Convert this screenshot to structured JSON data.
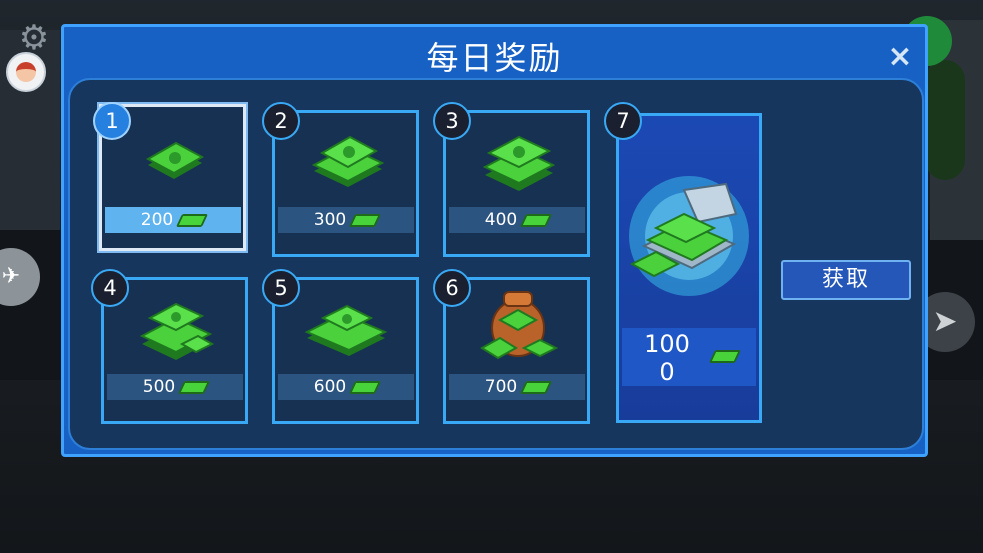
{
  "title": "每日奖励",
  "close_icon": "×",
  "claim_label": "获取",
  "days": [
    {
      "day": "1",
      "value": "200",
      "selected": true
    },
    {
      "day": "2",
      "value": "300"
    },
    {
      "day": "3",
      "value": "400"
    },
    {
      "day": "4",
      "value": "500"
    },
    {
      "day": "5",
      "value": "600"
    },
    {
      "day": "6",
      "value": "700"
    }
  ],
  "big_day": {
    "day": "7",
    "value_line1": "100",
    "value_line2": "0"
  },
  "colors": {
    "panel": "#1761c4",
    "border": "#3aa9f5",
    "cash": "#48d33a"
  }
}
